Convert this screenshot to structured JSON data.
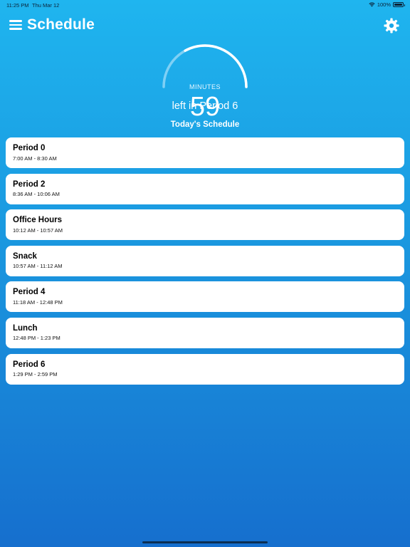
{
  "status_bar": {
    "time": "11:25 PM",
    "date": "Thu Mar 12",
    "battery": "100%"
  },
  "header": {
    "title": "Schedule",
    "menu_icon": "hamburger-menu-icon",
    "settings_icon": "gear-icon"
  },
  "timer": {
    "value": "59",
    "unit": "MINUTES",
    "label": "left in Period 6",
    "remaining_fraction": 0.66
  },
  "schedule": {
    "title": "Today's Schedule",
    "periods": [
      {
        "name": "Period 0",
        "time": "7:00 AM - 8:30 AM"
      },
      {
        "name": "Period 2",
        "time": "8:36 AM - 10:06 AM"
      },
      {
        "name": "Office Hours",
        "time": "10:12 AM - 10:57 AM"
      },
      {
        "name": "Snack",
        "time": "10:57 AM - 11:12 AM"
      },
      {
        "name": "Period 4",
        "time": "11:18 AM - 12:48 PM"
      },
      {
        "name": "Lunch",
        "time": "12:48 PM - 1:23 PM"
      },
      {
        "name": "Period 6",
        "time": "1:29 PM - 2:59 PM"
      }
    ]
  },
  "colors": {
    "background_top": "#1fb5ef",
    "background_bottom": "#166fce",
    "card": "#ffffff",
    "arc_track": "#7fd0f5"
  }
}
